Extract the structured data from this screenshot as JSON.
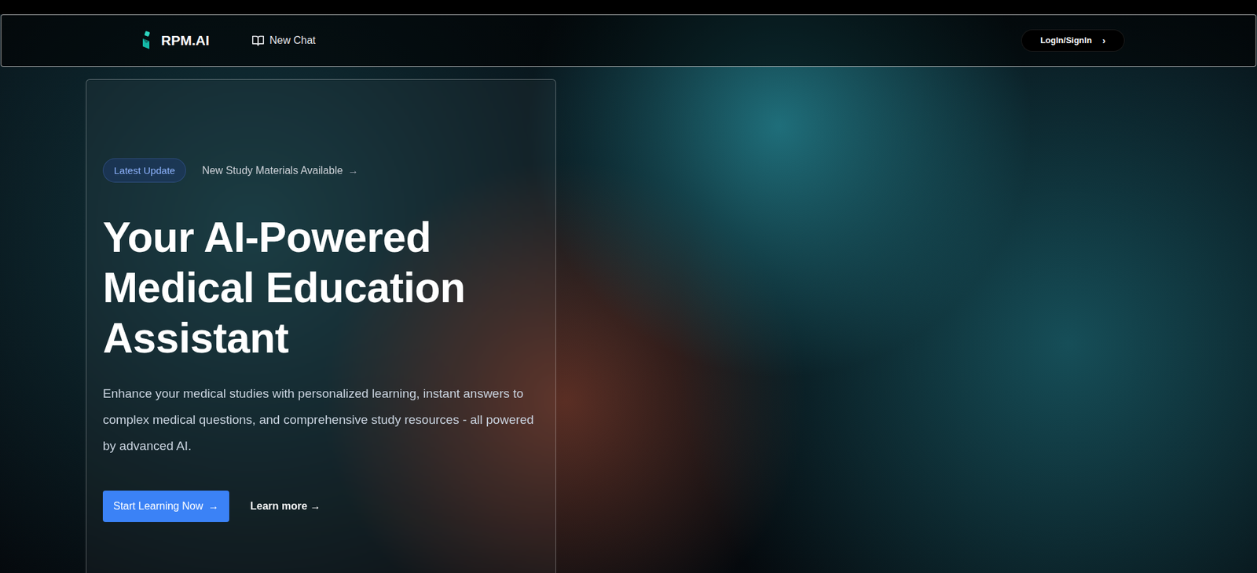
{
  "header": {
    "logo": "RPM.AI",
    "nav": [
      {
        "label": "New Chat"
      }
    ],
    "login": {
      "label": "LogIn/SignIn",
      "arrow": "›"
    }
  },
  "hero": {
    "badge": {
      "label": "Latest Update",
      "text": "New Study Materials Available",
      "arrow": "→"
    },
    "title": [
      "Your AI-Powered",
      "Medical Education",
      "Assistant"
    ],
    "description": "Enhance your medical studies with personalized learning, instant answers to complex medical questions, and comprehensive study resources - all powered by advanced AI.",
    "primary_button": {
      "label": "Start Learning Now",
      "arrow": "→"
    },
    "secondary_button": {
      "label": "Learn more →"
    }
  }
}
